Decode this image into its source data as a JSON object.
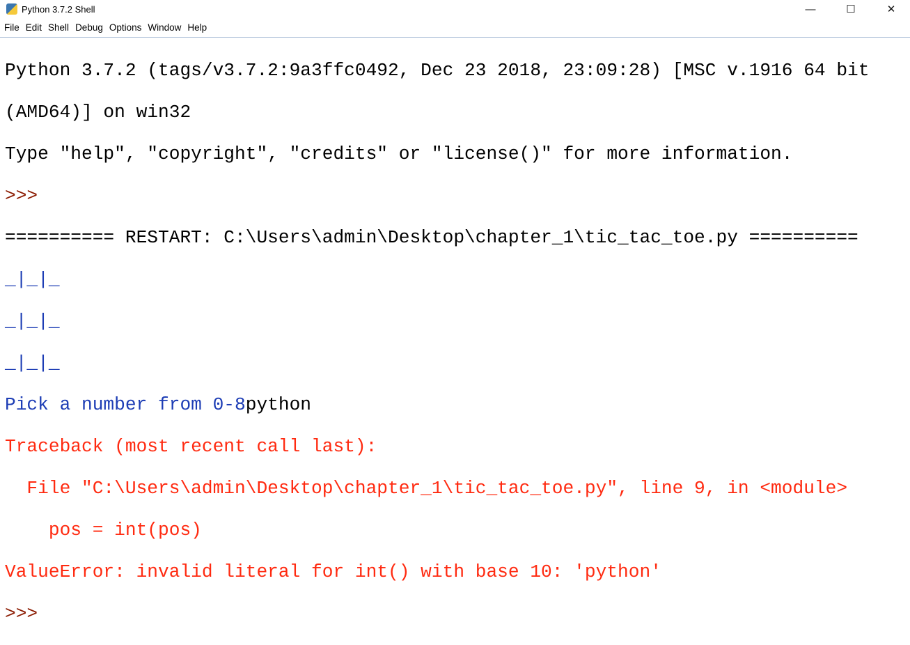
{
  "window": {
    "title": "Python 3.7.2 Shell",
    "minimize": "—",
    "maximize": "☐",
    "close": "✕"
  },
  "menu": [
    "File",
    "Edit",
    "Shell",
    "Debug",
    "Options",
    "Window",
    "Help"
  ],
  "shell": {
    "banner1": "Python 3.7.2 (tags/v3.7.2:9a3ffc0492, Dec 23 2018, 23:09:28) [MSC v.1916 64 bit",
    "banner2": "(AMD64)] on win32",
    "banner3": "Type \"help\", \"copyright\", \"credits\" or \"license()\" for more information.",
    "prompt": ">>>",
    "restart": "========== RESTART: C:\\Users\\admin\\Desktop\\chapter_1\\tic_tac_toe.py ==========",
    "board": [
      "_|_|_",
      "_|_|_",
      "_|_|_"
    ],
    "pick_prompt": "Pick a number from 0-8",
    "user_input": "python",
    "traceback": [
      "Traceback (most recent call last):",
      "  File \"C:\\Users\\admin\\Desktop\\chapter_1\\tic_tac_toe.py\", line 9, in <module>",
      "    pos = int(pos)",
      "ValueError: invalid literal for int() with base 10: 'python'"
    ],
    "final_prompt": ">>>"
  }
}
